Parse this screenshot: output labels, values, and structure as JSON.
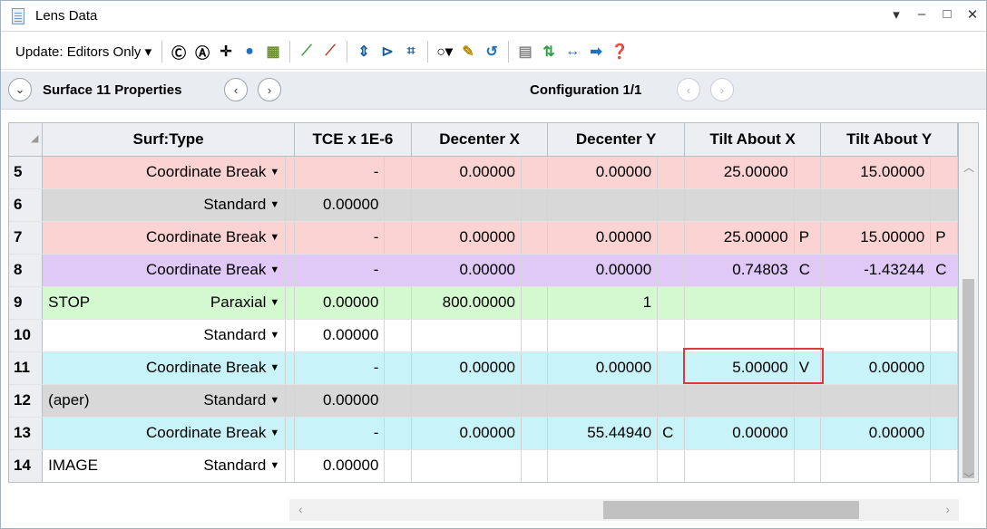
{
  "window": {
    "title": "Lens Data"
  },
  "toolbar": {
    "update_label": "Update: Editors Only ▾"
  },
  "subbar": {
    "surface_label": "Surface  11 Properties",
    "config_label": "Configuration 1/1"
  },
  "columns": [
    "Surf:Type",
    "TCE x 1E-6",
    "Decenter X",
    "Decenter Y",
    "Tilt About X",
    "Tilt About Y"
  ],
  "rows": [
    {
      "n": "5",
      "comment": "",
      "type": "Coordinate Break",
      "tce": "-",
      "dx": "0.00000",
      "dxf": "",
      "dy": "0.00000",
      "dyf": "",
      "tx": "25.00000",
      "txf": "",
      "ty": "15.00000",
      "tyf": "",
      "bg": "#fbd3d3"
    },
    {
      "n": "6",
      "comment": "",
      "type": "Standard",
      "tce": "0.00000",
      "dx": "",
      "dxf": "",
      "dy": "",
      "dyf": "",
      "tx": "",
      "txf": "",
      "ty": "",
      "tyf": "",
      "bg": "#d8d8d8"
    },
    {
      "n": "7",
      "comment": "",
      "type": "Coordinate Break",
      "tce": "-",
      "dx": "0.00000",
      "dxf": "",
      "dy": "0.00000",
      "dyf": "",
      "tx": "25.00000",
      "txf": "P",
      "ty": "15.00000",
      "tyf": "P",
      "bg": "#fbd3d3"
    },
    {
      "n": "8",
      "comment": "",
      "type": "Coordinate Break",
      "tce": "-",
      "dx": "0.00000",
      "dxf": "",
      "dy": "0.00000",
      "dyf": "",
      "tx": "0.74803",
      "txf": "C",
      "ty": "-1.43244",
      "tyf": "C",
      "bg": "#e0c8f7"
    },
    {
      "n": "9",
      "comment": "STOP",
      "type": "Paraxial",
      "tce": "0.00000",
      "dx": "800.00000",
      "dxf": "",
      "dy": "1",
      "dyf": "",
      "tx": "",
      "txf": "",
      "ty": "",
      "tyf": "",
      "bg": "#d4f8d0"
    },
    {
      "n": "10",
      "comment": "",
      "type": "Standard",
      "tce": "0.00000",
      "dx": "",
      "dxf": "",
      "dy": "",
      "dyf": "",
      "tx": "",
      "txf": "",
      "ty": "",
      "tyf": "",
      "bg": "#ffffff"
    },
    {
      "n": "11",
      "comment": "",
      "type": "Coordinate Break",
      "tce": "-",
      "dx": "0.00000",
      "dxf": "",
      "dy": "0.00000",
      "dyf": "",
      "tx": "5.00000",
      "txf": "V",
      "ty": "0.00000",
      "tyf": "",
      "bg": "#c8f3f8"
    },
    {
      "n": "12",
      "comment": "(aper)",
      "type": "Standard",
      "tce": "0.00000",
      "dx": "",
      "dxf": "",
      "dy": "",
      "dyf": "",
      "tx": "",
      "txf": "",
      "ty": "",
      "tyf": "",
      "bg": "#d8d8d8"
    },
    {
      "n": "13",
      "comment": "",
      "type": "Coordinate Break",
      "tce": "-",
      "dx": "0.00000",
      "dxf": "",
      "dy": "55.44940",
      "dyf": "C",
      "tx": "0.00000",
      "txf": "",
      "ty": "0.00000",
      "tyf": "",
      "bg": "#c8f3f8"
    },
    {
      "n": "14",
      "comment": "IMAGE",
      "type": "Standard",
      "tce": "0.00000",
      "dx": "",
      "dxf": "",
      "dy": "",
      "dyf": "",
      "tx": "",
      "txf": "",
      "ty": "",
      "tyf": "",
      "bg": "#ffffff"
    }
  ]
}
